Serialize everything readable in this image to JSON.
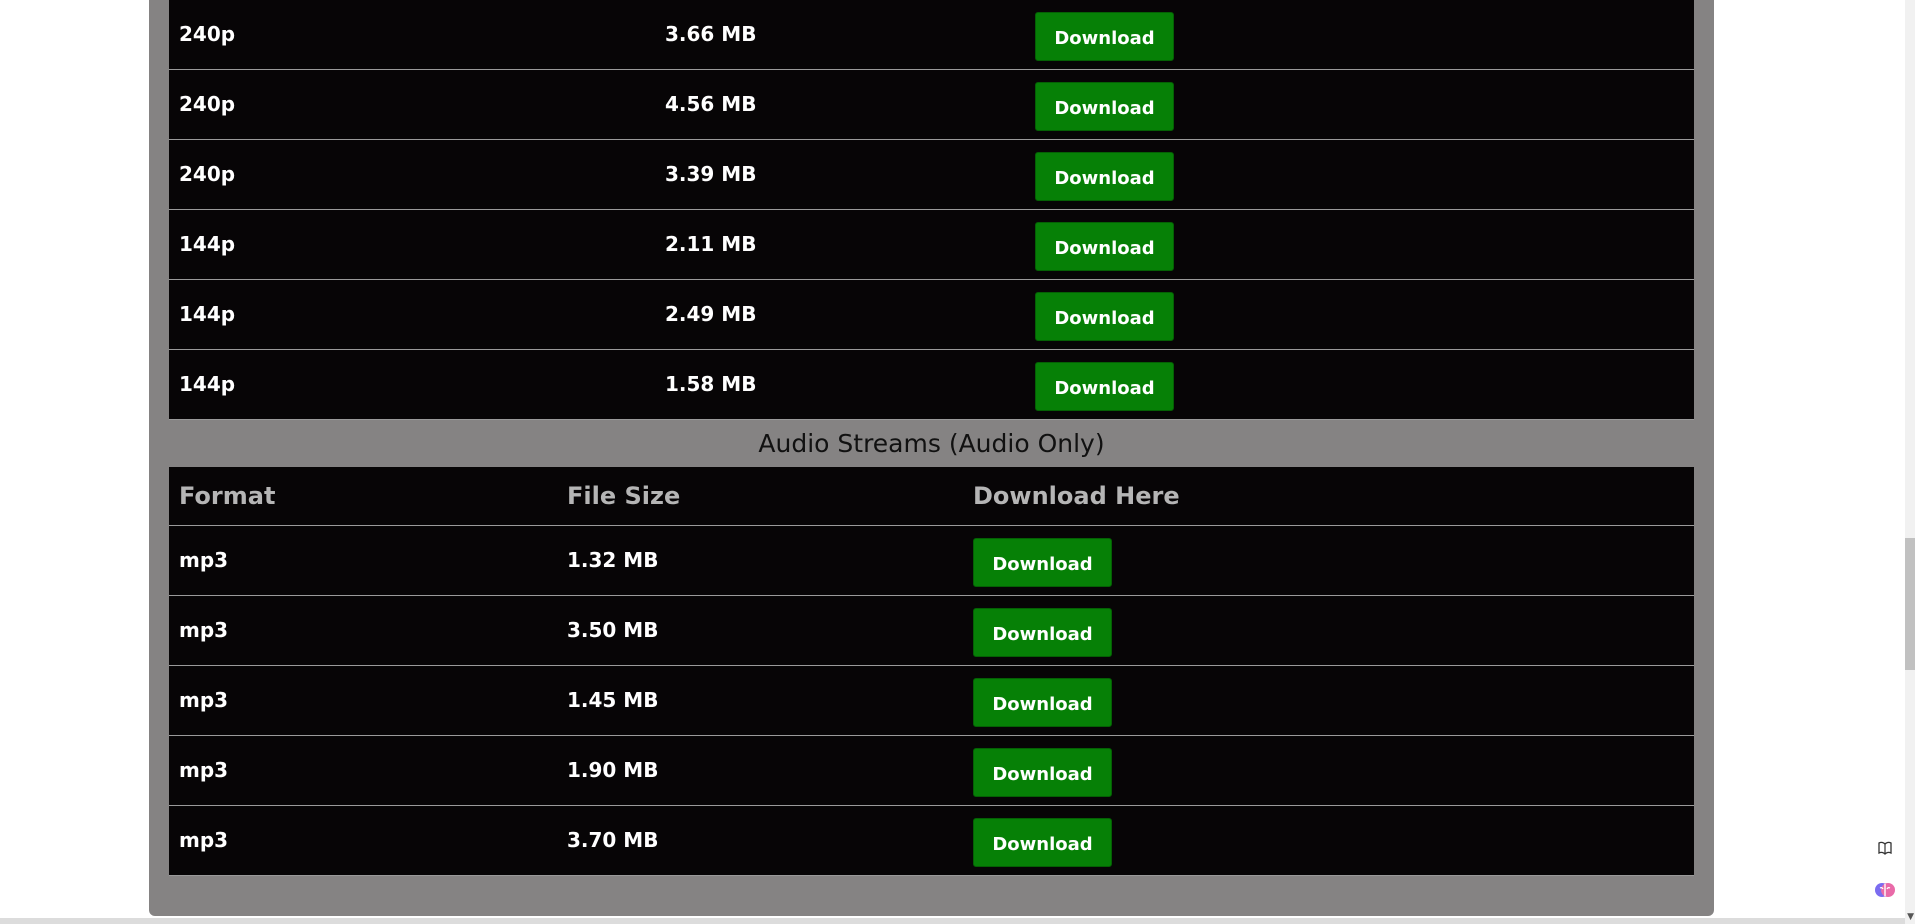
{
  "video_rows": [
    {
      "format": "240p",
      "size": "3.66 MB",
      "button": "Download"
    },
    {
      "format": "240p",
      "size": "4.56 MB",
      "button": "Download"
    },
    {
      "format": "240p",
      "size": "3.39 MB",
      "button": "Download"
    },
    {
      "format": "144p",
      "size": "2.11 MB",
      "button": "Download"
    },
    {
      "format": "144p",
      "size": "2.49 MB",
      "button": "Download"
    },
    {
      "format": "144p",
      "size": "1.58 MB",
      "button": "Download"
    }
  ],
  "audio_section": {
    "title": "Audio Streams (Audio Only)",
    "headers": {
      "format": "Format",
      "size": "File Size",
      "download": "Download Here"
    },
    "rows": [
      {
        "format": "mp3",
        "size": "1.32 MB",
        "button": "Download"
      },
      {
        "format": "mp3",
        "size": "3.50 MB",
        "button": "Download"
      },
      {
        "format": "mp3",
        "size": "1.45 MB",
        "button": "Download"
      },
      {
        "format": "mp3",
        "size": "1.90 MB",
        "button": "Download"
      },
      {
        "format": "mp3",
        "size": "3.70 MB",
        "button": "Download"
      }
    ]
  },
  "icons": {
    "reader": "book-icon",
    "extension": "brain-icon"
  },
  "colors": {
    "button": "#068006",
    "table_bg": "#070506",
    "panel_bg": "#858383"
  }
}
